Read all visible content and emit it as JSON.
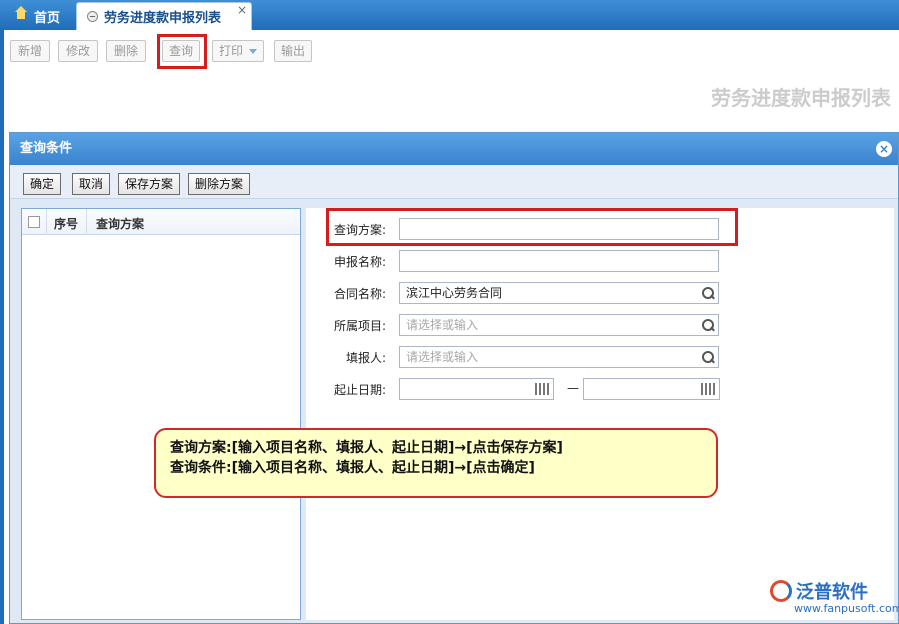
{
  "tabs": {
    "home": "首页",
    "active": "劳务进度款申报列表",
    "close_symbol": "×"
  },
  "toolbar": {
    "add": "新增",
    "edit": "修改",
    "delete": "删除",
    "query": "查询",
    "print": "打印",
    "export": "输出"
  },
  "page_title": "劳务进度款申报列表",
  "dialog": {
    "title": "查询条件",
    "close_symbol": "×",
    "buttons": {
      "confirm": "确定",
      "cancel": "取消",
      "save_plan": "保存方案",
      "delete_plan": "删除方案"
    },
    "list": {
      "col_index": "序号",
      "col_plan": "查询方案"
    },
    "form": {
      "plan_label": "查询方案:",
      "plan_value": "",
      "report_name_label": "申报名称:",
      "report_name_value": "",
      "contract_label": "合同名称:",
      "contract_value": "滨江中心劳务合同",
      "project_label": "所属项目:",
      "project_placeholder": "请选择或输入",
      "reporter_label": "填报人:",
      "reporter_placeholder": "请选择或输入",
      "date_label": "起止日期:",
      "date_sep": "—"
    }
  },
  "annotation": {
    "line1": "查询方案:[输入项目名称、填报人、起止日期]→[点击保存方案]",
    "line2": "查询条件:[输入项目名称、填报人、起止日期]→[点击确定]"
  },
  "logo": {
    "name": "泛普软件",
    "url": "www.fanpusoft.com"
  },
  "colors": {
    "brand_blue": "#1f6db8",
    "highlight_red": "#d21e1e",
    "note_bg": "#ffffc8"
  }
}
